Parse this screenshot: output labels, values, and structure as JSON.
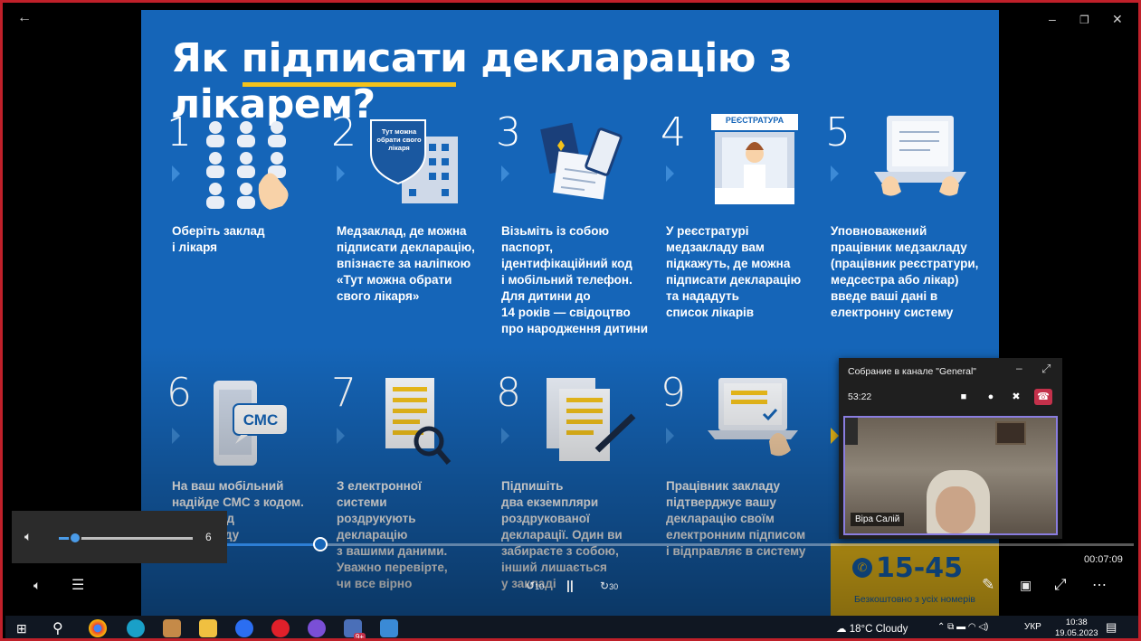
{
  "window": {
    "back": "←",
    "minimize": "–",
    "restore": "❐",
    "close": "✕"
  },
  "slide": {
    "title": "Як підписати декларацію з лікарем?",
    "steps": [
      {
        "num": "1",
        "text": "Оберіть заклад\nі лікаря"
      },
      {
        "num": "2",
        "text": "Медзаклад, де можна\nпідписати декларацію,\nвпізнаєте за наліпкою\n«Тут можна обрати\nсвого лікаря»",
        "sticker": "Тут можна обрати свого лікаря"
      },
      {
        "num": "3",
        "text": "Візьміть із собою\nпаспорт,\nідентифікаційний код\nі мобільний телефон.\nДля дитини до\n14 років — свідоцтво\nпро народження дитини"
      },
      {
        "num": "4",
        "text": "У реєстратурі\nмедзакладу вам\nпідкажуть, де можна\nпідписати декларацію\nта нададуть\nсписок лікарів",
        "sign": "РЕЄСТРАТУРА"
      },
      {
        "num": "5",
        "text": "Уповноважений\nпрацівник медзакладу\n(працівник реєстратури,\nмедсестра або лікар)\nвведе ваші дані в\nелектронну систему"
      },
      {
        "num": "6",
        "text": "На ваш мобільний\nнадійде СМС з кодом.\nте цей код\nжу закладу",
        "sms": "СМС"
      },
      {
        "num": "7",
        "text": "З електронної\nсистеми\nроздрукують\nдекларацію\nз вашими даними.\nУважно перевірте,\nчи все вірно"
      },
      {
        "num": "8",
        "text": "Підпишіть\nдва екземпляри\nроздрукованої\nдекларації. Один ви\nзабираєте з собою,\nінший лишається\nу закладі"
      },
      {
        "num": "9",
        "text": "Працівник закладу\nпідтверджує вашу\nдекларацію своїм\nелектронним підписом\nі відправляє в систему"
      }
    ],
    "hotline": {
      "number": "15-45",
      "note": "Безкоштовно з усіх номерів"
    }
  },
  "player": {
    "volume_value": "6",
    "volume_fraction": 0.12,
    "progress_fraction": 0.275,
    "time": "00:07:09",
    "rewind_label": "10",
    "forward_label": "30",
    "pause_icon": "||"
  },
  "teams": {
    "title": "Собрание в канале \"General\"",
    "timer": "53:22",
    "participant": "Віра Салій"
  },
  "taskbar": {
    "weather": "18°C  Cloudy",
    "lang": "УКР",
    "time": "10:38",
    "date": "19.05.2023",
    "badge": "9+"
  }
}
